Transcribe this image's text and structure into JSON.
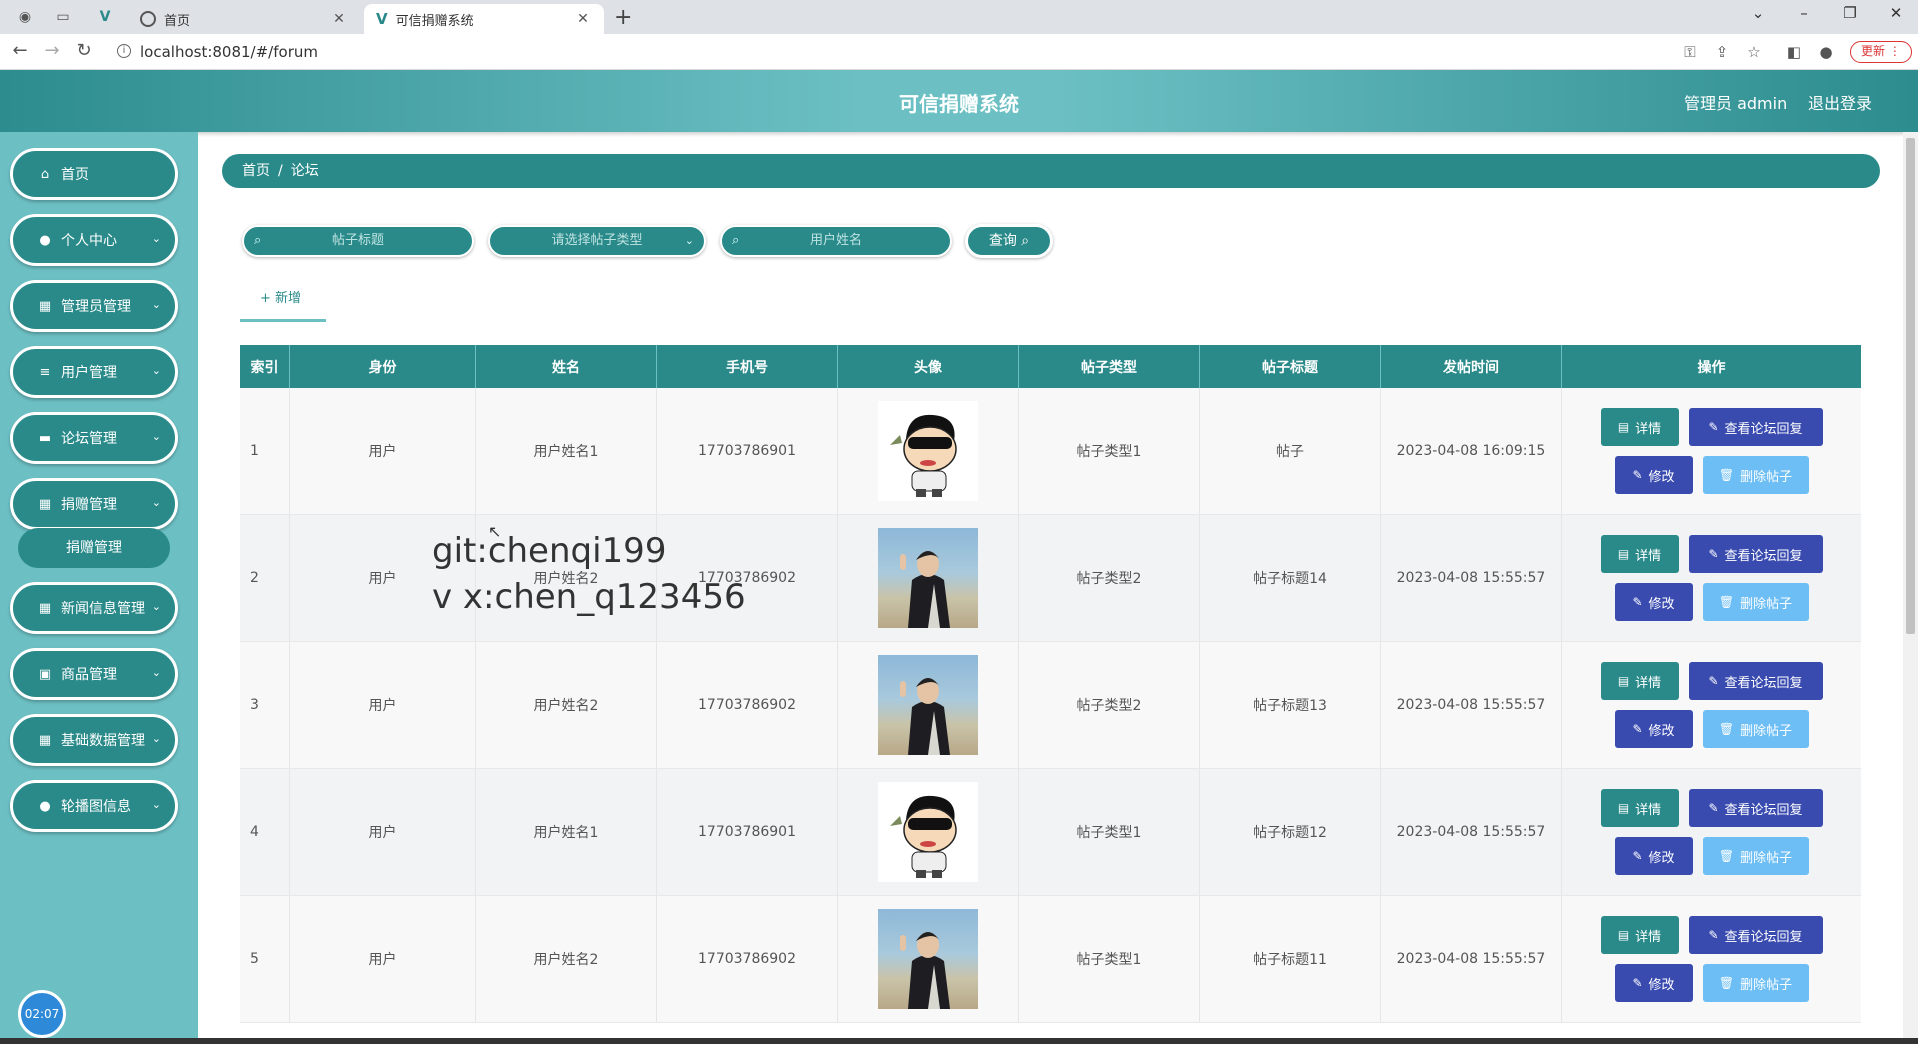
{
  "browser": {
    "tabs": [
      {
        "title": "首页",
        "favicon": "globe-icon",
        "active": false
      },
      {
        "title": "可信捐赠系统",
        "favicon": "vue-icon",
        "active": true
      }
    ],
    "url": "localhost:8081/#/forum",
    "update_label": "更新"
  },
  "header": {
    "title": "可信捐赠系统",
    "user": "管理员 admin",
    "logout": "退出登录"
  },
  "sidebar": {
    "items": [
      {
        "label": "首页",
        "icon": "home-icon"
      },
      {
        "label": "个人中心",
        "icon": "user-icon"
      },
      {
        "label": "管理员管理",
        "icon": "grid-icon"
      },
      {
        "label": "用户管理",
        "icon": "list-icon"
      },
      {
        "label": "论坛管理",
        "icon": "chat-icon"
      },
      {
        "label": "捐赠管理",
        "icon": "grid-icon"
      },
      {
        "label": "新闻信息管理",
        "icon": "grid-icon"
      },
      {
        "label": "商品管理",
        "icon": "clipboard-icon"
      },
      {
        "label": "基础数据管理",
        "icon": "grid-icon"
      },
      {
        "label": "轮播图信息",
        "icon": "user-icon"
      }
    ],
    "sub_item": "捐赠管理",
    "clock": "02:07"
  },
  "breadcrumb": {
    "home": "首页",
    "current": "论坛"
  },
  "search": {
    "title_placeholder": "帖子标题",
    "type_placeholder": "请选择帖子类型",
    "username_placeholder": "用户姓名",
    "query_label": "查询"
  },
  "add_label": "新增",
  "table": {
    "columns": [
      "索引",
      "身份",
      "姓名",
      "手机号",
      "头像",
      "帖子类型",
      "帖子标题",
      "发帖时间",
      "操作"
    ],
    "rows": [
      {
        "index": "1",
        "role": "用户",
        "name": "用户姓名1",
        "phone": "17703786901",
        "avatar": "cartoon",
        "type": "帖子类型1",
        "title": "帖子",
        "time": "2023-04-08 16:09:15"
      },
      {
        "index": "2",
        "role": "用户",
        "name": "用户姓名2",
        "phone": "17703786902",
        "avatar": "photo",
        "type": "帖子类型2",
        "title": "帖子标题14",
        "time": "2023-04-08 15:55:57"
      },
      {
        "index": "3",
        "role": "用户",
        "name": "用户姓名2",
        "phone": "17703786902",
        "avatar": "photo",
        "type": "帖子类型2",
        "title": "帖子标题13",
        "time": "2023-04-08 15:55:57"
      },
      {
        "index": "4",
        "role": "用户",
        "name": "用户姓名1",
        "phone": "17703786901",
        "avatar": "cartoon",
        "type": "帖子类型1",
        "title": "帖子标题12",
        "time": "2023-04-08 15:55:57"
      },
      {
        "index": "5",
        "role": "用户",
        "name": "用户姓名2",
        "phone": "17703786902",
        "avatar": "photo",
        "type": "帖子类型1",
        "title": "帖子标题11",
        "time": "2023-04-08 15:55:57"
      }
    ],
    "actions": {
      "detail": "详情",
      "reply": "查看论坛回复",
      "edit": "修改",
      "delete": "删除帖子"
    }
  },
  "watermark": {
    "line1": "git:chenqi199",
    "line2": "v x:chen_q123456"
  },
  "colors": {
    "primary": "#2a8a8a",
    "light": "#6cc0c4",
    "indigo": "#3a4bb0",
    "skyblue": "#6cbef5"
  }
}
